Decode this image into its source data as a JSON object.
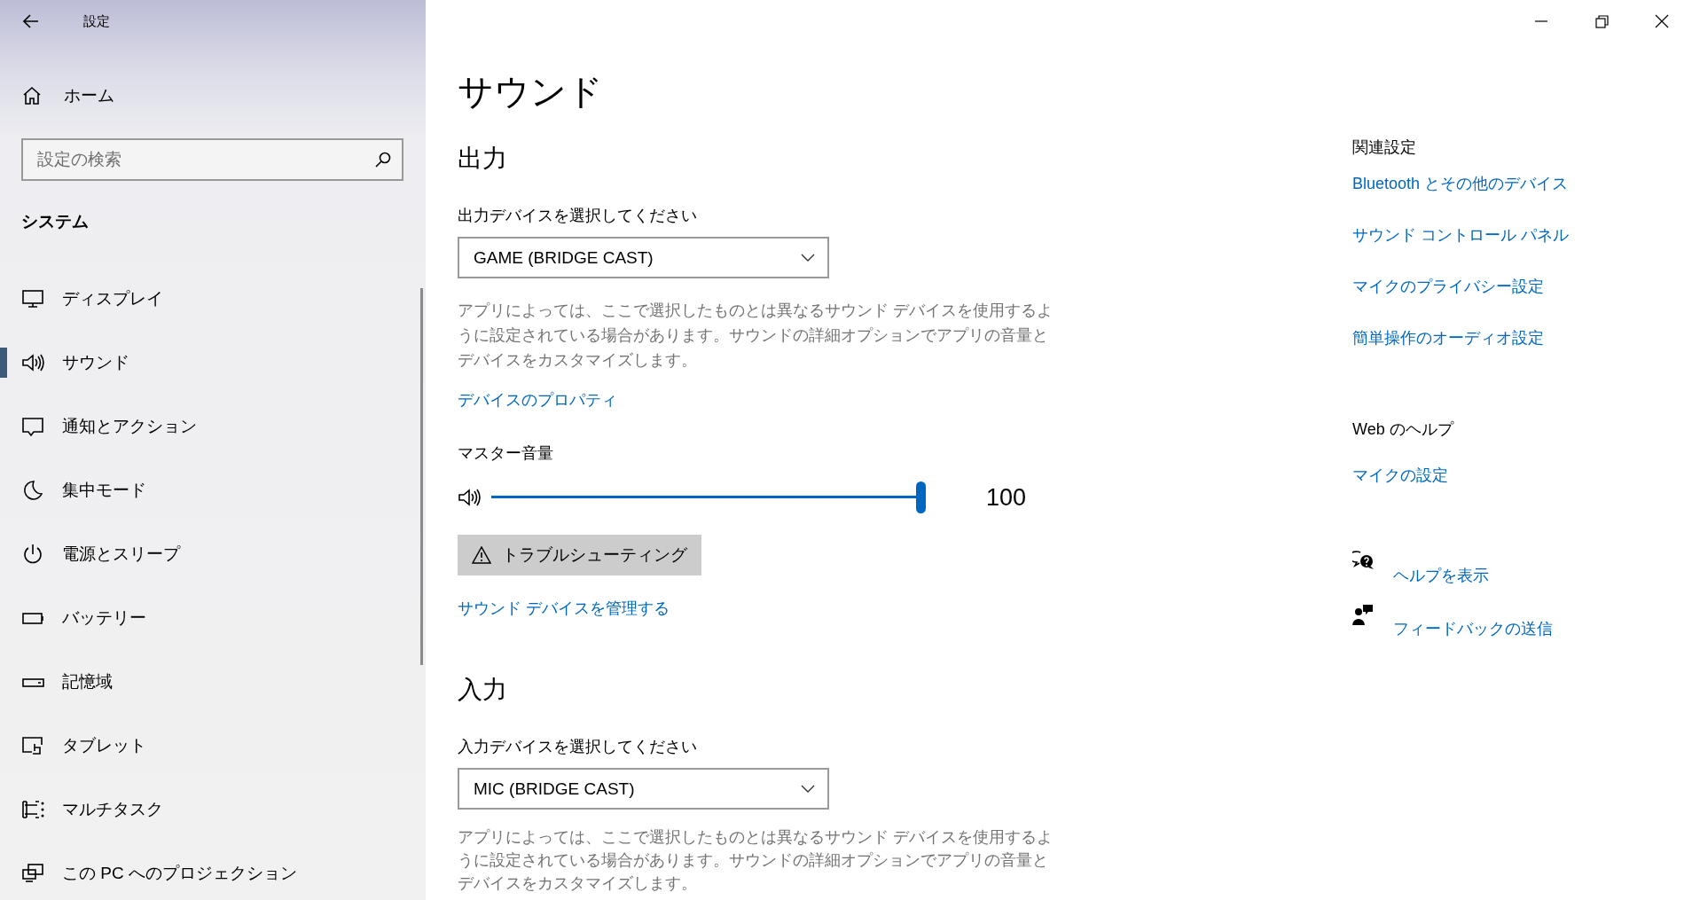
{
  "window": {
    "title": "設定"
  },
  "sidebar": {
    "home": "ホーム",
    "search": {
      "placeholder": "設定の検索"
    },
    "section": "システム",
    "items": [
      {
        "label": "ディスプレイ",
        "selected": false
      },
      {
        "label": "サウンド",
        "selected": true
      },
      {
        "label": "通知とアクション",
        "selected": false
      },
      {
        "label": "集中モード",
        "selected": false
      },
      {
        "label": "電源とスリープ",
        "selected": false
      },
      {
        "label": "バッテリー",
        "selected": false
      },
      {
        "label": "記憶域",
        "selected": false
      },
      {
        "label": "タブレット",
        "selected": false
      },
      {
        "label": "マルチタスク",
        "selected": false
      },
      {
        "label": "この PC へのプロジェクション",
        "selected": false
      }
    ]
  },
  "main": {
    "title": "サウンド",
    "sections": [
      {
        "heading": "出力",
        "device_label": "出力デバイスを選択してください",
        "device": "GAME (BRIDGE CAST)",
        "description": "アプリによっては、ここで選択したものとは異なるサウンド デバイスを使用するように設定されている場合があります。サウンドの詳細オプションでアプリの音量とデバイスをカスタマイズします。",
        "properties_link": "デバイスのプロパティ",
        "volume": {
          "label": "マスター音量",
          "level": 1.0,
          "reading": "100"
        },
        "troubleshoot": "トラブルシューティング",
        "manage_link": "サウンド デバイスを管理する"
      },
      {
        "heading": "入力",
        "device_label": "入力デバイスを選択してください",
        "device": "MIC (BRIDGE CAST)",
        "description": "アプリによっては、ここで選択したものとは異なるサウンド デバイスを使用するように設定されている場合があります。サウンドの詳細オプションでアプリの音量とデバイスをカスタマイズします。"
      }
    ]
  },
  "related": {
    "heading": "関連設定",
    "links": [
      "Bluetooth とその他のデバイス",
      "サウンド コントロール パネル",
      "マイクのプライバシー設定",
      "簡単操作のオーディオ設定"
    ]
  },
  "web_help": {
    "heading": "Web のヘルプ",
    "links": [
      "マイクの設定"
    ]
  },
  "support": [
    {
      "label": "ヘルプを表示"
    },
    {
      "label": "フィードバックの送信"
    }
  ]
}
